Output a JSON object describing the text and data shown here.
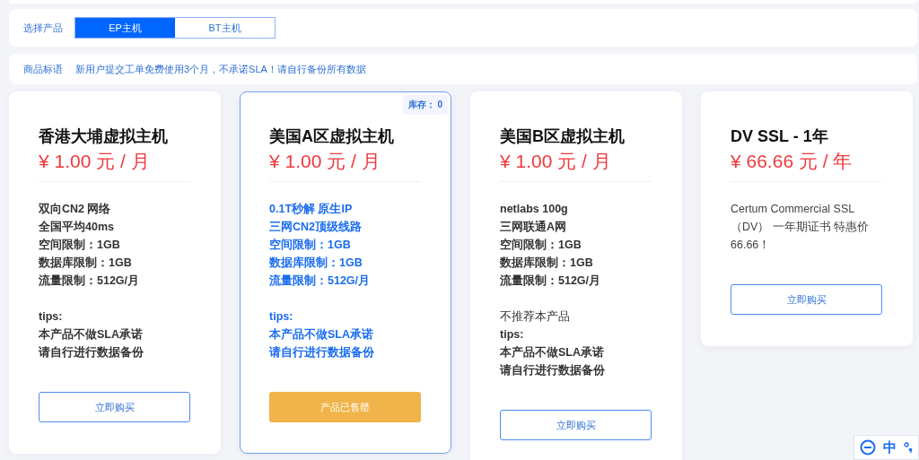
{
  "selector": {
    "label": "选择产品",
    "tabs": [
      {
        "label": "EP主机",
        "selected": true
      },
      {
        "label": "BT主机",
        "selected": false
      }
    ]
  },
  "notice": {
    "label": "商品标语",
    "text": "新用户提交工单免费使用3个月，不承诺SLA！请自行备份所有数据"
  },
  "products": [
    {
      "title": "香港大埔虚拟主机",
      "price": "¥ 1.00 元 / 月",
      "selected": false,
      "specs": [
        "双向CN2 网络",
        "全国平均40ms",
        "空间限制：1GB",
        "数据库限制：1GB",
        "流量限制：512G/月"
      ],
      "notes": [
        {
          "text": "tips:",
          "bold": true
        },
        {
          "text": "本产品不做SLA承诺",
          "bold": true
        },
        {
          "text": "请自行进行数据备份",
          "bold": true
        }
      ],
      "button": {
        "label": "立即购买",
        "kind": "buy"
      }
    },
    {
      "title": "美国A区虚拟主机",
      "price": "¥ 1.00 元 / 月",
      "selected": true,
      "stock": "库存： 0",
      "specs": [
        "0.1T秒解 原生IP",
        "三网CN2顶级线路",
        "空间限制：1GB",
        "数据库限制：1GB",
        "流量限制：512G/月"
      ],
      "notes": [
        {
          "text": "tips:",
          "bold": true
        },
        {
          "text": "本产品不做SLA承诺",
          "bold": true
        },
        {
          "text": "请自行进行数据备份",
          "bold": true
        }
      ],
      "button": {
        "label": "产品已售罄",
        "kind": "sold_out"
      }
    },
    {
      "title": "美国B区虚拟主机",
      "price": "¥ 1.00 元 / 月",
      "selected": false,
      "specs": [
        "netlabs 100g",
        "三网联通A网",
        "空间限制：1GB",
        "数据库限制：1GB",
        "流量限制：512G/月"
      ],
      "notes": [
        {
          "text": "不推荐本产品",
          "bold": false
        },
        {
          "text": "tips:",
          "bold": true
        },
        {
          "text": "本产品不做SLA承诺",
          "bold": true
        },
        {
          "text": "请自行进行数据备份",
          "bold": true
        }
      ],
      "button": {
        "label": "立即购买",
        "kind": "buy"
      }
    },
    {
      "title": "DV SSL - 1年",
      "price": "¥ 66.66 元 / 年",
      "selected": false,
      "description": "Certum Commercial SSL（DV） 一年期证书 特惠价66.66！",
      "button": {
        "label": "立即购买",
        "kind": "buy"
      }
    }
  ],
  "ime": {
    "mode": "中"
  }
}
